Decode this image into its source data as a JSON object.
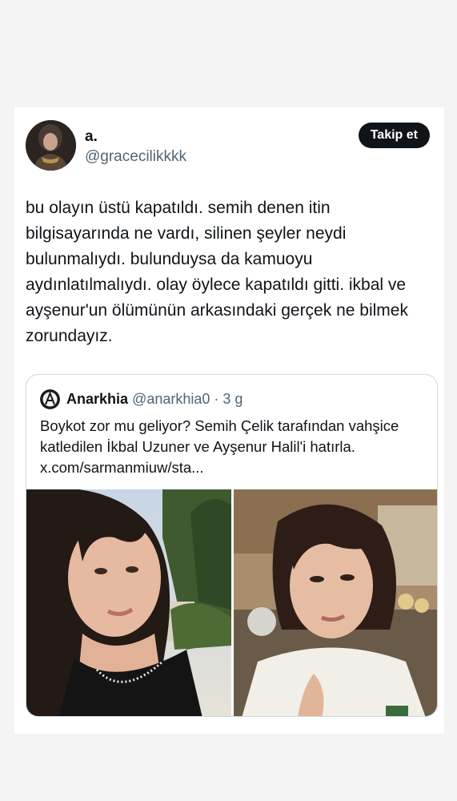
{
  "tweet": {
    "display_name": "a.",
    "handle": "@gracecilikkkk",
    "follow_label": "Takip et",
    "avatar_icon": "profile-photo",
    "text": "bu olayın üstü kapatıldı. semih denen itin bilgisayarında ne vardı, silinen şeyler neydi bulunmalıydı. bulunduysa da kamuoyu aydınlatılmalıydı. olay öylece kapatıldı gitti. ikbal ve ayşenur'un ölümünün arkasındaki gerçek ne bilmek zorundayız."
  },
  "quote": {
    "display_name": "Anarkhia",
    "handle": "@anarkhia0",
    "separator": "·",
    "time": "3 g",
    "text": "Boykot zor mu geliyor? Semih Çelik tarafından vahşice katledilen  İkbal Uzuner ve Ayşenur Halil'i hatırla. x.com/sarmanmiuw/sta...",
    "media": [
      {
        "icon": "photo-woman-outdoors"
      },
      {
        "icon": "photo-woman-kitchen"
      }
    ]
  },
  "colors": {
    "text": "#0f1419",
    "secondary": "#536471",
    "border": "#cfd9de",
    "button_bg": "#0f1419",
    "button_text": "#ffffff"
  }
}
